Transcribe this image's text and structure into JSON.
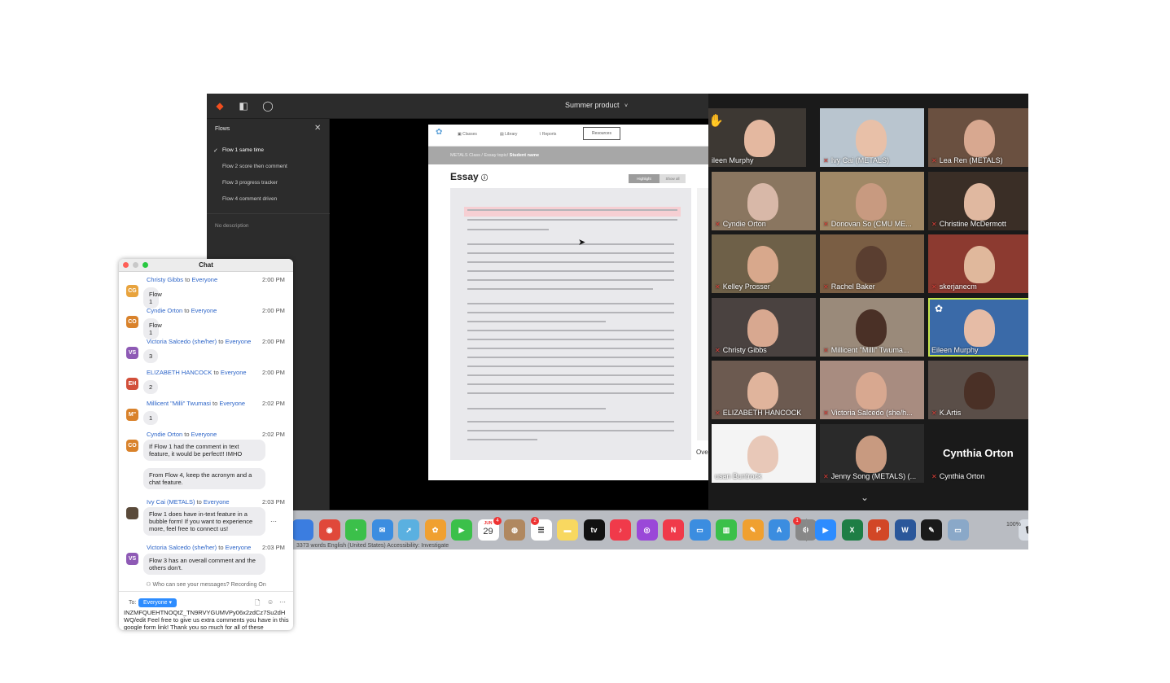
{
  "figma": {
    "file_title": "Summer product",
    "file_chevron": "˅",
    "flows_header": "Flows",
    "flows": [
      "Flow 1 same time",
      "Flow 2 score then comment",
      "Flow 3 progress tracker",
      "Flow 4 comment driven"
    ],
    "description": "No description"
  },
  "prototype": {
    "nav": [
      "Classes",
      "Library",
      "Reports"
    ],
    "resources_button": "Resources",
    "breadcrumb": "METALS Class / Essay topic/",
    "breadcrumb_bold": "Student name",
    "essay_title": "Essay",
    "highlight_button": "Highlight",
    "show_all_button": "Show all",
    "overall_label": "Ove"
  },
  "gallery": {
    "participants": [
      {
        "name": "Eileen Murphy",
        "label": "ileen Murphy",
        "muted": false,
        "hand": true
      },
      {
        "name": "Ivy Cai (METALS)",
        "label": "Ivy Cai (METALS)",
        "muted": true
      },
      {
        "name": "Lea Ren (METALS)",
        "label": "Lea Ren  (METALS)",
        "muted": true
      },
      {
        "name": "Cyndie Orton",
        "label": "Cyndie Orton",
        "muted": true
      },
      {
        "name": "Donovan So (CMU ME...",
        "label": "Donovan So (CMU ME...",
        "muted": true
      },
      {
        "name": "Christine McDermott",
        "label": "Christine McDermott",
        "muted": true
      },
      {
        "name": "Kelley Prosser",
        "label": "Kelley Prosser",
        "muted": true
      },
      {
        "name": "Rachel Baker",
        "label": "Rachel Baker",
        "muted": true
      },
      {
        "name": "skerjanecm",
        "label": "skerjanecm",
        "muted": true
      },
      {
        "name": "Christy Gibbs",
        "label": "Christy Gibbs",
        "muted": true
      },
      {
        "name": "Millicent \"Milli\" Twuma...",
        "label": "Millicent \"Milli\" Twuma...",
        "muted": true
      },
      {
        "name": "Eileen Murphy",
        "label": "Eileen Murphy",
        "muted": false,
        "active": true
      },
      {
        "name": "ELIZABETH HANCOCK",
        "label": "ELIZABETH HANCOCK",
        "muted": true
      },
      {
        "name": "Victoria Salcedo (she/h...",
        "label": "Victoria Salcedo (she/h...",
        "muted": true
      },
      {
        "name": "K.Artis",
        "label": "K.Artis",
        "muted": true
      },
      {
        "name": "Susan Buntrock",
        "label": "usan Buntrock",
        "muted": false
      },
      {
        "name": "Jenny Song (METALS) (...",
        "label": "Jenny Song (METALS) (...",
        "muted": true
      },
      {
        "name": "Cynthia Orton",
        "label": "Cynthia Orton",
        "muted": true,
        "no_video": true
      }
    ],
    "no_video_name": "Cynthia Orton"
  },
  "dock": {
    "calendar_month": "JUN",
    "calendar_day": "29",
    "calendar_badge": "4",
    "reminders_badge": "2",
    "settings_badge": "1",
    "tv_label": "tv",
    "strip_text": "3373 words     English (United States)     Accessibility: Investigate",
    "zoom_percent": "100%"
  },
  "chat": {
    "title": "Chat",
    "to_word": "to",
    "messages": [
      {
        "sender": "Christy Gibbs",
        "to": "Everyone",
        "time": "2:00 PM",
        "initials": "CG",
        "color": "#e8a33d",
        "bubbles": [
          "Flow 1"
        ]
      },
      {
        "sender": "Cyndie Orton",
        "to": "Everyone",
        "time": "2:00 PM",
        "initials": "CO",
        "color": "#d9822b",
        "bubbles": [
          "Flow 1"
        ]
      },
      {
        "sender": "Victoria Salcedo (she/her)",
        "to": "Everyone",
        "time": "2:00 PM",
        "initials": "VS",
        "color": "#8e5ab5",
        "bubbles": [
          "3"
        ]
      },
      {
        "sender": "ELIZABETH HANCOCK",
        "to": "Everyone",
        "time": "2:00 PM",
        "initials": "EH",
        "color": "#d24f3a",
        "bubbles": [
          "2"
        ]
      },
      {
        "sender": "Millicent \"Milli\" Twumasi",
        "to": "Everyone",
        "time": "2:02 PM",
        "initials": "M\"",
        "color": "#d9822b",
        "bubbles": [
          "1"
        ]
      },
      {
        "sender": "Cyndie Orton",
        "to": "Everyone",
        "time": "2:02 PM",
        "initials": "CO",
        "color": "#d9822b",
        "bubbles": [
          "If Flow 1 had the comment in text feature, it would be perfect!! IMHO",
          "From Flow 4, keep the acronym and a chat feature."
        ]
      },
      {
        "sender": "Ivy Cai (METALS)",
        "to": "Everyone",
        "time": "2:03 PM",
        "initials": "",
        "color": "#5a4a3a",
        "bubbles": [
          "Flow 1 does have in-text feature in a bubble form! If you want to experience more, feel free to connect us!"
        ]
      },
      {
        "sender": "Victoria Salcedo (she/her)",
        "to": "Everyone",
        "time": "2:03 PM",
        "initials": "VS",
        "color": "#8e5ab5",
        "bubbles": [
          "Flow 3 has an overall comment and the others don't."
        ]
      }
    ],
    "footer": "Who can see your messages? Recording On",
    "to_label": "To:",
    "to_value": "Everyone",
    "draft": "INZMFQUEHTNOQtZ_TN9RVYGUMVPy06x2zdCz7Su2dH WQ/edit Feel free to give us extra comments you have in this google form link! Thank you so much for all of these"
  }
}
